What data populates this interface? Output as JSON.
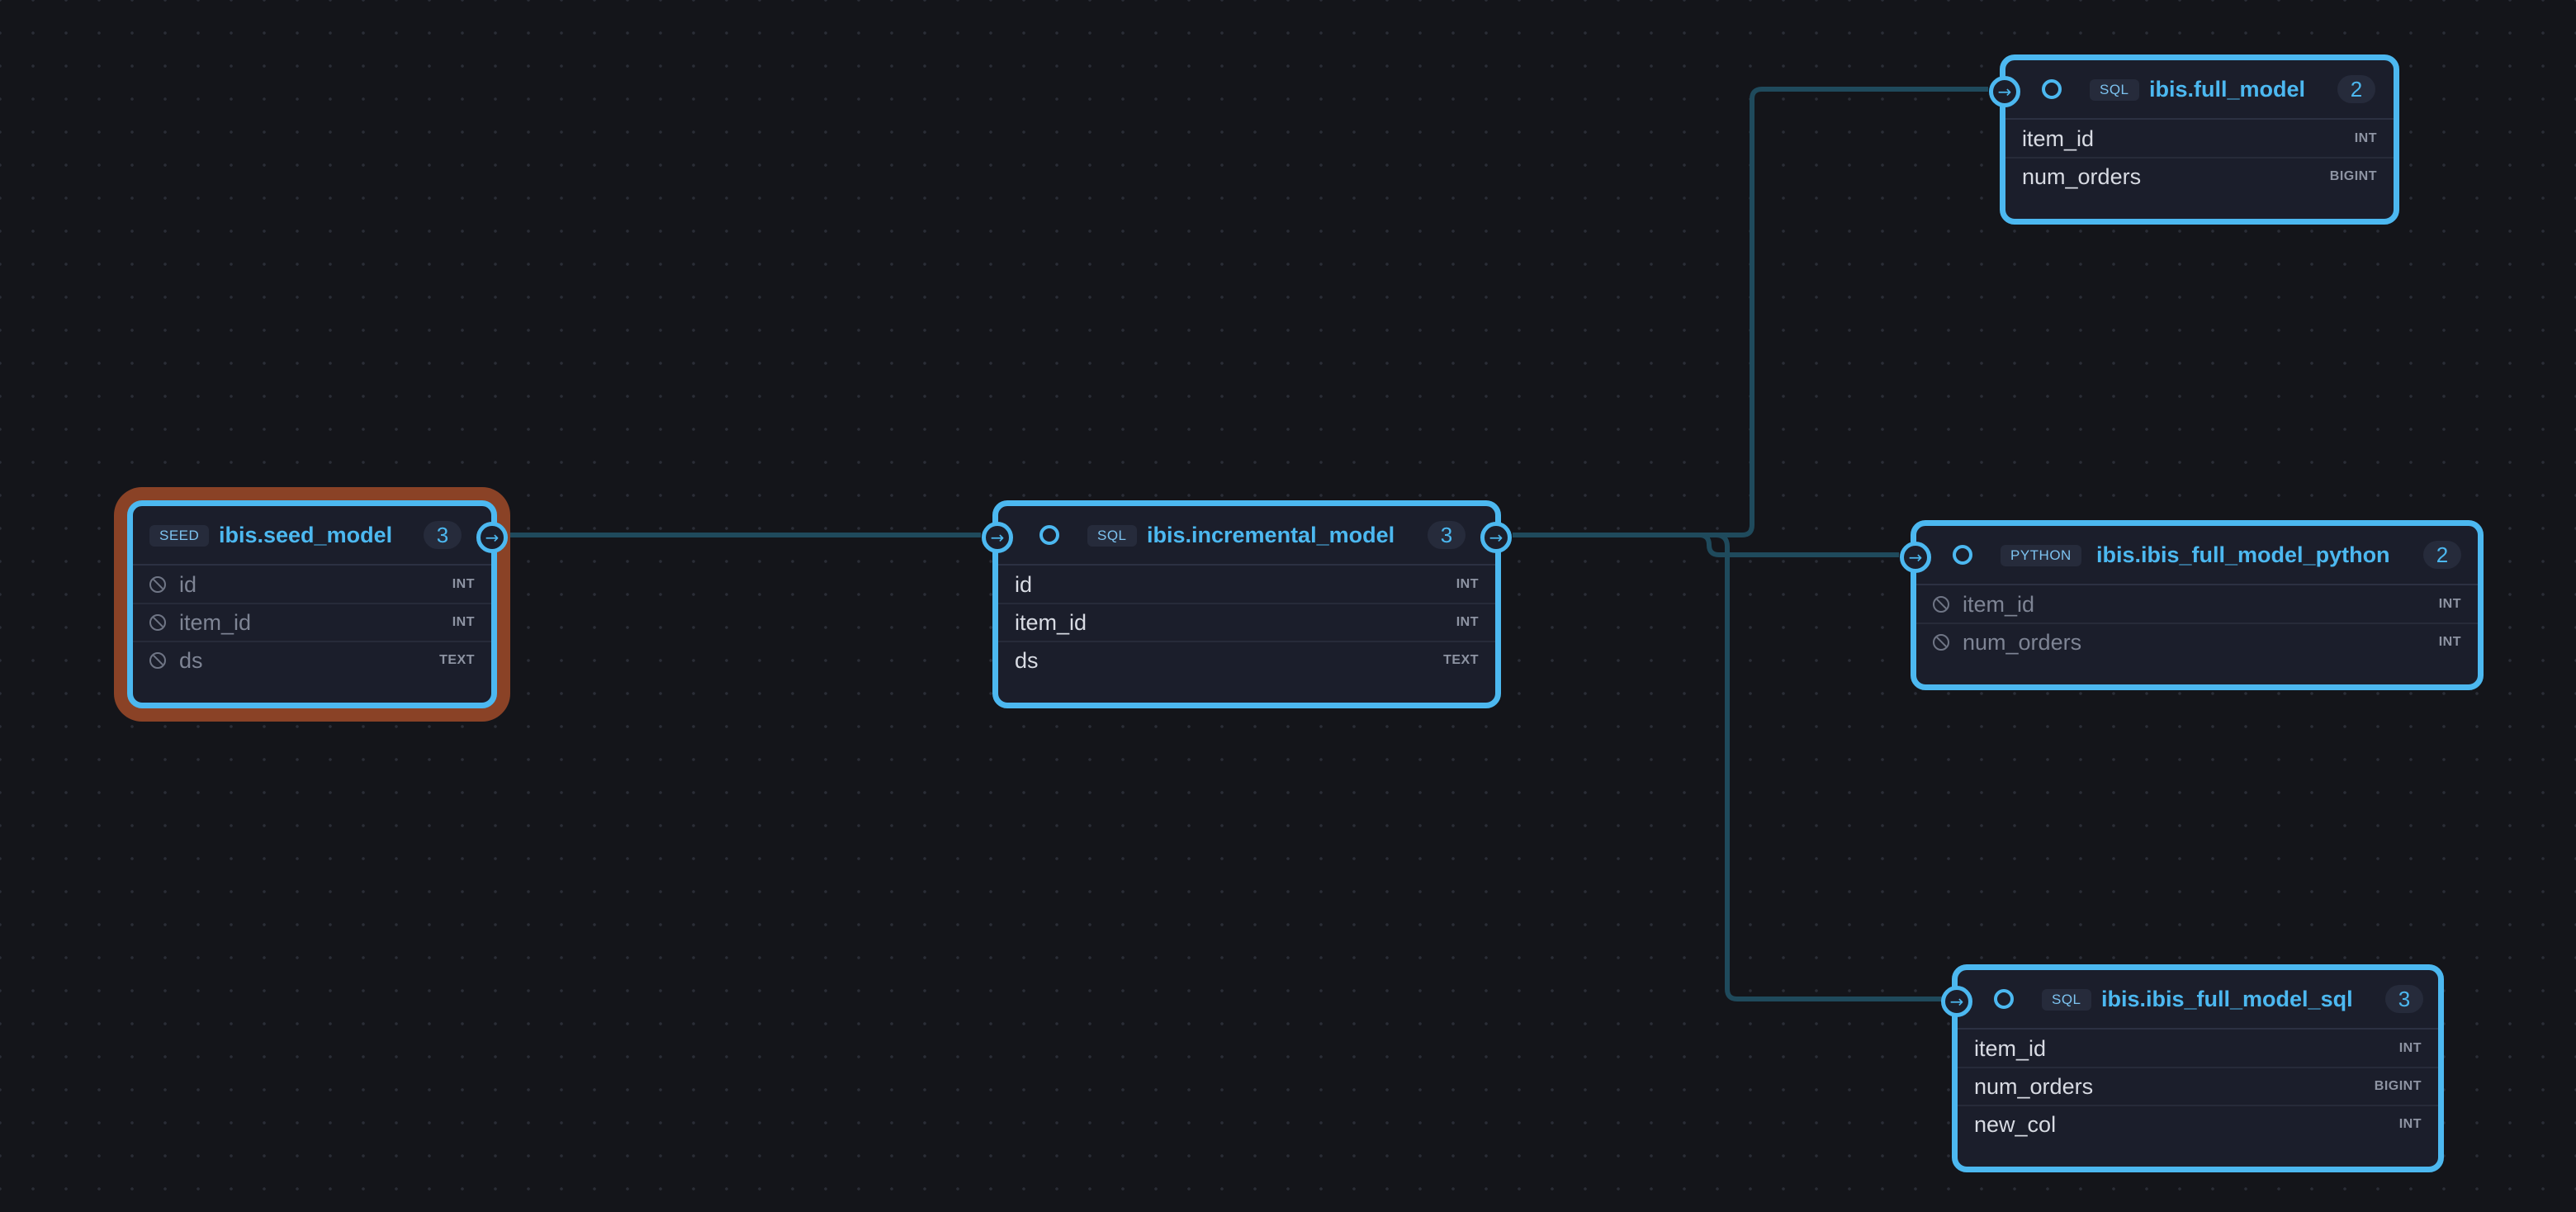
{
  "colors": {
    "background": "#14151a",
    "node_border": "#4cb8f0",
    "node_fill": "#1b1e2b",
    "selected_outline": "#8a4226",
    "edge": "#1f4a5c"
  },
  "nodes": {
    "seed_model": {
      "kind": "SEED",
      "name": "ibis.seed_model",
      "count": "3",
      "columns": [
        {
          "name": "id",
          "type": "INT"
        },
        {
          "name": "item_id",
          "type": "INT"
        },
        {
          "name": "ds",
          "type": "TEXT"
        }
      ]
    },
    "incremental_model": {
      "kind": "SQL",
      "name": "ibis.incremental_model",
      "count": "3",
      "columns": [
        {
          "name": "id",
          "type": "INT"
        },
        {
          "name": "item_id",
          "type": "INT"
        },
        {
          "name": "ds",
          "type": "TEXT"
        }
      ]
    },
    "full_model": {
      "kind": "SQL",
      "name": "ibis.full_model",
      "count": "2",
      "columns": [
        {
          "name": "item_id",
          "type": "INT"
        },
        {
          "name": "num_orders",
          "type": "BIGINT"
        }
      ]
    },
    "full_model_python": {
      "kind": "PYTHON",
      "name": "ibis.ibis_full_model_python",
      "count": "2",
      "columns": [
        {
          "name": "item_id",
          "type": "INT"
        },
        {
          "name": "num_orders",
          "type": "INT"
        }
      ]
    },
    "full_model_sql": {
      "kind": "SQL",
      "name": "ibis.ibis_full_model_sql",
      "count": "3",
      "columns": [
        {
          "name": "item_id",
          "type": "INT"
        },
        {
          "name": "num_orders",
          "type": "BIGINT"
        },
        {
          "name": "new_col",
          "type": "INT"
        }
      ]
    }
  },
  "icons": {
    "port_arrow": "arrow-right-icon",
    "status": "circle-icon",
    "column_disabled": "ban-icon"
  }
}
